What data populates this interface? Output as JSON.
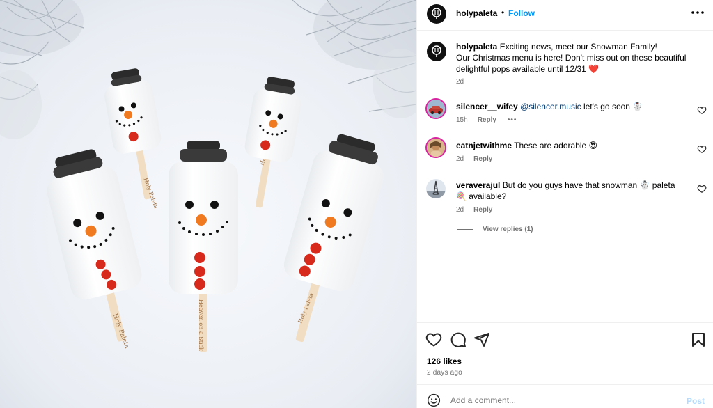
{
  "post": {
    "username": "holypaleta",
    "follow_label": "Follow",
    "separator": "•",
    "more_icon": "more-horizontal-icon",
    "photo_stick_texts": [
      "Holy Paleta",
      "Holy Paleta",
      "Holy Paleta",
      "Heaven on a Stick",
      "Holy Paleta"
    ]
  },
  "caption": {
    "username": "holypaleta",
    "text": "Exciting news, meet our Snowman Family!\nOur Christmas menu is here! Don't miss out on these beautiful delightful pops available until 12/31 ❤️",
    "time": "2d"
  },
  "comments": [
    {
      "username": "silencer__wifey",
      "mention": "@silencer.music",
      "text": " let's go soon ☃️",
      "time": "15h",
      "reply_label": "Reply",
      "more_label": "•••"
    },
    {
      "username": "eatnjetwithme",
      "text": "These are adorable 😍",
      "time": "2d",
      "reply_label": "Reply"
    },
    {
      "username": "veraverajul",
      "text": "But do you guys have that snowman ☃️ paleta 🍭 available?",
      "time": "2d",
      "reply_label": "Reply",
      "view_replies": "View replies (1)"
    }
  ],
  "actions": {
    "like_icon": "heart-icon",
    "comment_icon": "comment-icon",
    "share_icon": "share-icon",
    "save_icon": "bookmark-icon"
  },
  "likes": "126 likes",
  "posted": "2 days ago",
  "add_comment": {
    "placeholder": "Add a comment...",
    "post_label": "Post",
    "emoji_icon": "emoji-icon"
  },
  "colors": {
    "follow": "#0095f6",
    "mention": "#00376b",
    "muted": "#737373",
    "post_disabled": "#b3dbff"
  }
}
